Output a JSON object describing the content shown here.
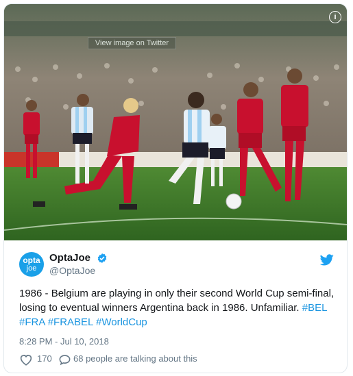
{
  "media": {
    "alt": "",
    "view_on_twitter": "View image on Twitter",
    "info_symbol": "i"
  },
  "author": {
    "avatar_line1": "opta",
    "avatar_line2": "joe",
    "name": "OptaJoe",
    "handle": "@OptaJoe",
    "verified": true
  },
  "tweet": {
    "text_before": "1986 - Belgium are playing in only their second World Cup semi-final, losing to eventual winners Argentina back in 1986. Unfamiliar. ",
    "hashtags": [
      "#BEL",
      "#FRA",
      "#FRABEL",
      "#WorldCup"
    ],
    "timestamp": "8:28 PM - Jul 10, 2018"
  },
  "actions": {
    "likes": "170",
    "replies_text": "68 people are talking about this"
  },
  "colors": {
    "twitter_blue": "#1da1f2",
    "hashtag": "#1b95e0",
    "muted": "#657786",
    "belgium_red": "#c8102e",
    "argentina_sky": "#9fd0f0"
  },
  "icons": {
    "info": "info-icon",
    "verified": "verified-badge-icon",
    "bird": "twitter-bird-icon",
    "like": "heart-icon",
    "reply": "speech-bubble-icon"
  }
}
